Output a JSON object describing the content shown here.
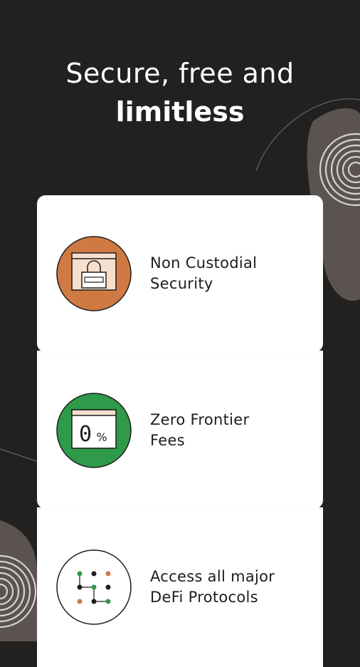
{
  "headline": {
    "line1": "Secure, free and",
    "line2": "limitless"
  },
  "features": [
    {
      "label_line1": "Non Custodial",
      "label_line2": "Security",
      "icon": "padlock-window-icon",
      "color": "#d07a43"
    },
    {
      "label_line1": "Zero Frontier",
      "label_line2": "Fees",
      "icon": "zero-percent-icon",
      "color": "#2f9a4a",
      "icon_text": "0%"
    },
    {
      "label_line1": "Access all major",
      "label_line2": "DeFi Protocols",
      "icon": "protocol-network-icon",
      "color": "#ffffff"
    }
  ],
  "colors": {
    "background": "#222120",
    "card": "#ffffff",
    "accent_orange": "#d07a43",
    "accent_green": "#2f9a4a"
  }
}
